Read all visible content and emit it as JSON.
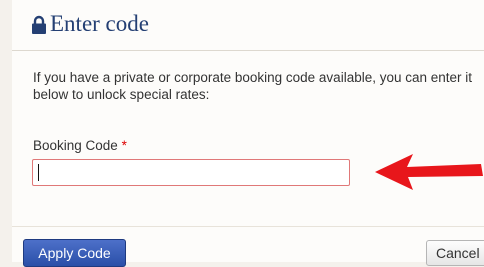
{
  "dialog": {
    "title": "Enter code",
    "title_icon": "lock-icon",
    "description": "If you have a private or corporate booking code available, you can enter it below to unlock special rates:"
  },
  "form": {
    "booking_code": {
      "label": "Booking Code",
      "required_marker": "*",
      "value": ""
    }
  },
  "annotation": {
    "icon": "red-arrow-icon",
    "color": "#e8161b"
  },
  "buttons": {
    "apply_label": "Apply Code",
    "cancel_label": "Cancel"
  },
  "colors": {
    "title": "#243f73",
    "primary_button": "#3558b5",
    "input_error_border": "#e07878",
    "required_marker": "#dd0000"
  }
}
